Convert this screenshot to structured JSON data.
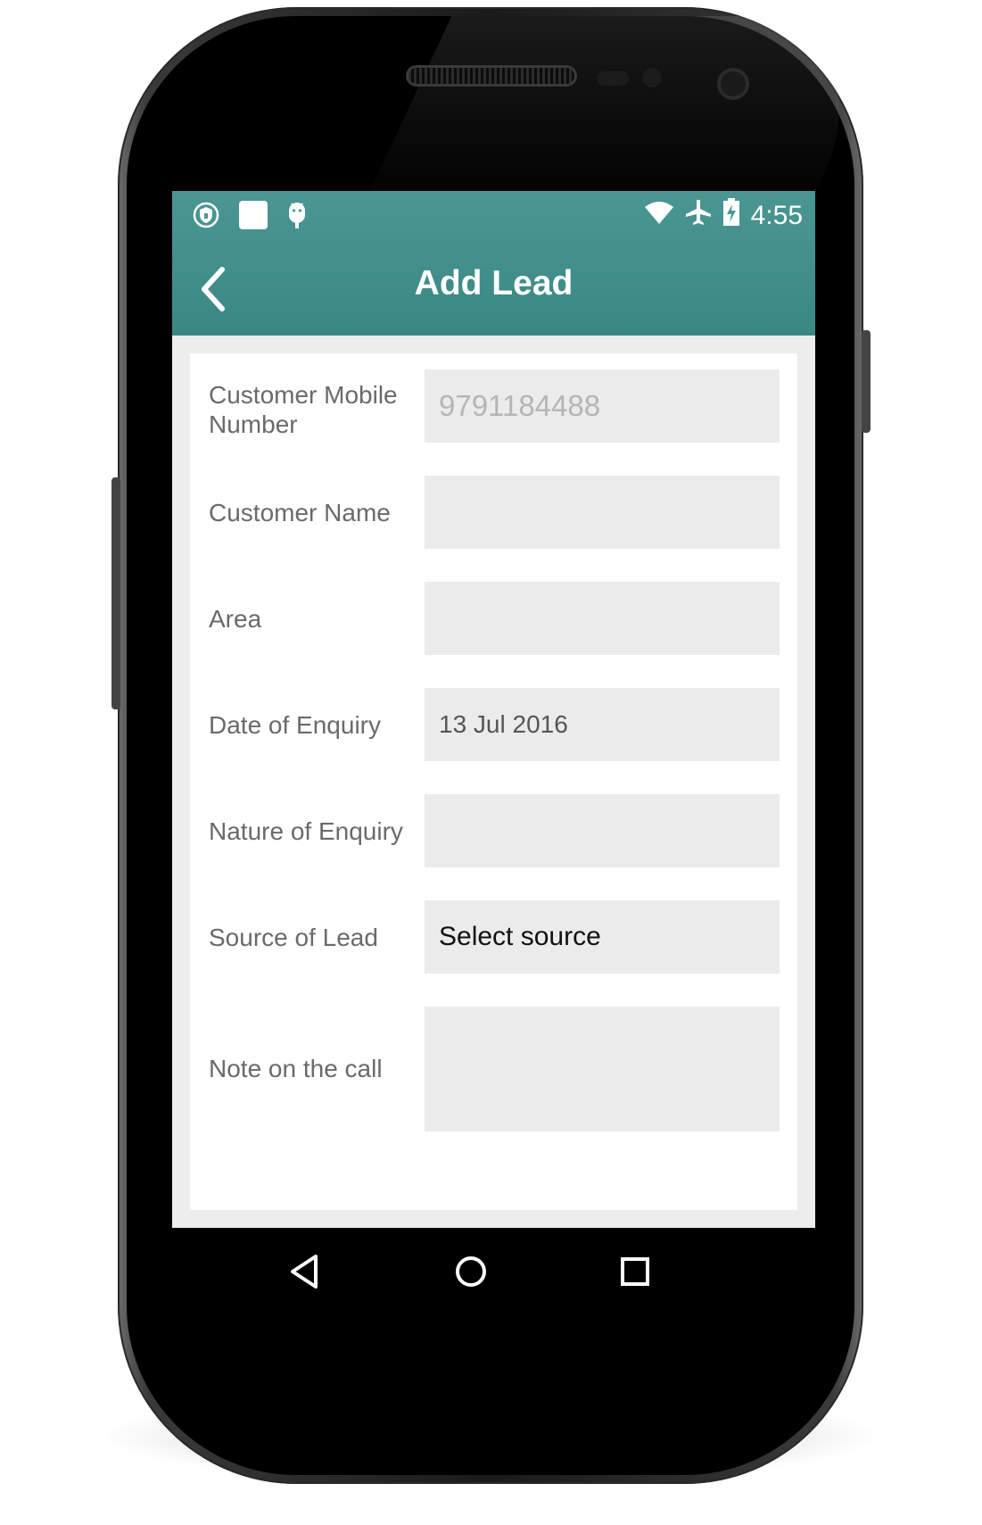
{
  "status_bar": {
    "left_icons": [
      "shield-icon",
      "notification-square-icon",
      "android-icon"
    ],
    "right_icons": [
      "wifi-icon",
      "airplane-icon",
      "battery-charging-icon"
    ],
    "time": "4:55"
  },
  "app_bar": {
    "title": "Add Lead",
    "back_icon": "chevron-left-icon"
  },
  "form": {
    "fields": [
      {
        "label": "Customer Mobile Number",
        "value": "",
        "placeholder": "9791184488"
      },
      {
        "label": "Customer Name",
        "value": "",
        "placeholder": ""
      },
      {
        "label": "Area",
        "value": "",
        "placeholder": ""
      },
      {
        "label": "Date of Enquiry",
        "value": "13 Jul 2016",
        "placeholder": ""
      },
      {
        "label": "Nature of Enquiry",
        "value": "",
        "placeholder": ""
      },
      {
        "label": "Source of Lead",
        "value": "Select source",
        "placeholder": ""
      },
      {
        "label": "Note on the call",
        "value": "",
        "placeholder": ""
      }
    ]
  },
  "nav_bar": {
    "buttons": [
      "back-triangle-icon",
      "home-circle-icon",
      "recents-square-icon"
    ]
  },
  "colors": {
    "primary": "#3f8f8a",
    "background": "#ededed",
    "field_bg": "#ebebeb",
    "label_text": "#6a6a6a"
  }
}
